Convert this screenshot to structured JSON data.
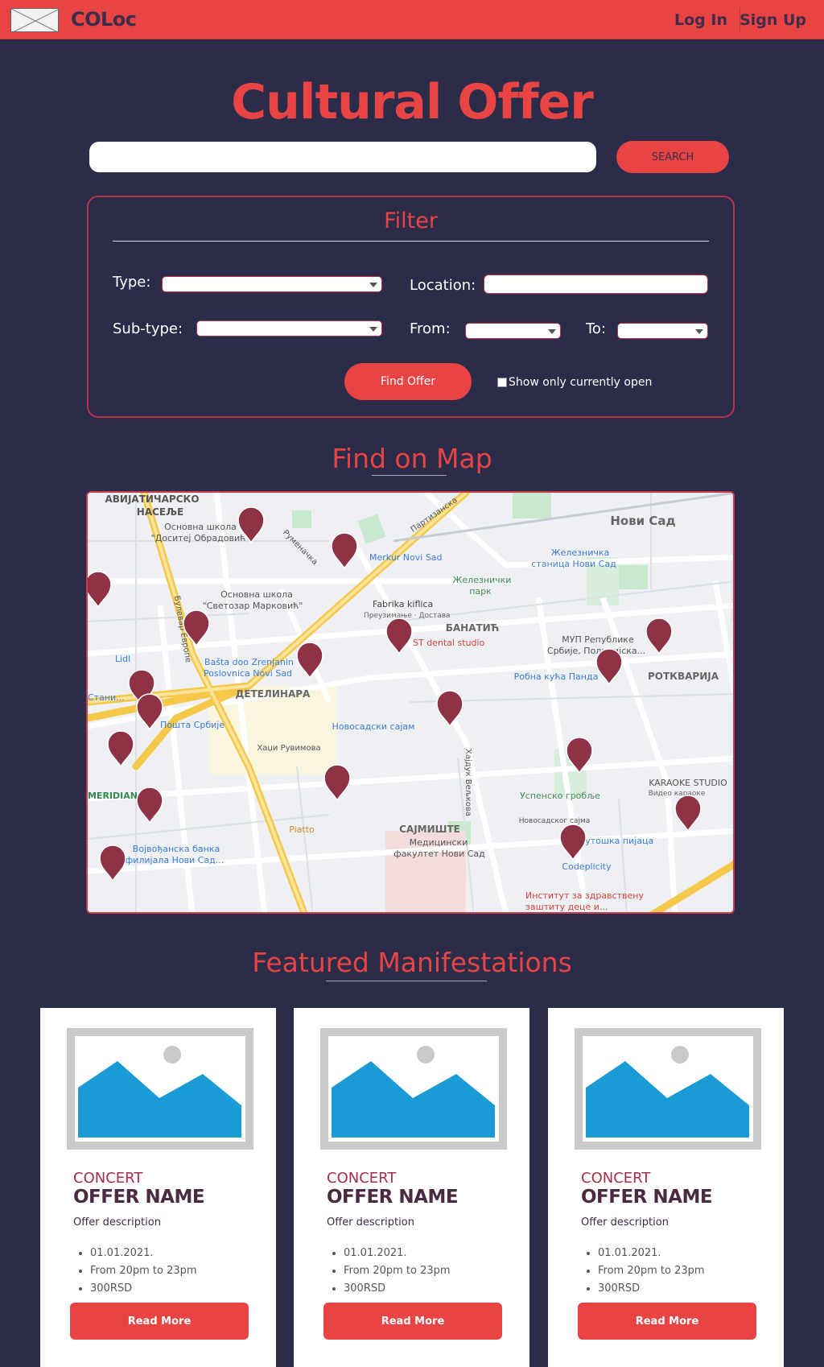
{
  "header": {
    "brand": "COLoc",
    "login_label": "Log In",
    "signup_label": "Sign Up"
  },
  "hero": {
    "title": "Cultural Offer",
    "search_value": "",
    "search_button": "SEARCH"
  },
  "filter": {
    "title": "Filter",
    "type_label": "Type:",
    "location_label": "Location:",
    "subtype_label": "Sub-type:",
    "from_label": "From:",
    "to_label": "To:",
    "find_button": "Find Offer",
    "open_checkbox_label": "Show only currently open"
  },
  "map_section": {
    "title": "Find on Map",
    "labels": [
      "АВИЈАТИЧАРСКО",
      "НАСЕЉЕ",
      "Основна школа",
      "\"Доситеј Обрадовић\"",
      "Нови Сад",
      "Merkur Novi Sad",
      "Железничка",
      "станица Нови Сад",
      "Железнички",
      "парк",
      "Основна школа",
      "\"Светозар Марковић\"",
      "Fabrika kiflica",
      "Преузимање · Достава",
      "БАНАТИЋ",
      "ST dental studio",
      "МУП Републике",
      "Србије, Полицијска...",
      "Lidl",
      "Bašta doo Zrenjanin",
      "Poslovnica Novi Sad",
      "Робна кућа Панда",
      "РОТКВАРИЈА",
      "ДЕТЕЛИНАРА",
      "Новосадски сајам",
      "Пошта Србије",
      "Хаџи Рувимова",
      "Успенско гробље",
      "KARAOKE STUDIO",
      "Видео караоке",
      "MERIDIANA",
      "Piatto",
      "САЈМИШТЕ",
      "Медицински",
      "факултет Нови Сад",
      "Футошка пијаца",
      "Војвођанска банка",
      "филијала Нови Сад...",
      "Codeplicity",
      "Институт за здравствену",
      "заштиту деце и...",
      "Булевар Европе",
      "Руменачка",
      "Партизанска",
      "Новосадског сајма",
      "Хајдук Вељкова",
      "Стани..."
    ]
  },
  "featured": {
    "title": "Featured Manifestations",
    "cards": [
      {
        "type": "CONCERT",
        "name": "OFFER NAME",
        "description": "Offer description",
        "date": "01.01.2021.",
        "time": "From 20pm to 23pm",
        "price": "300RSD",
        "button": "Read More"
      },
      {
        "type": "CONCERT",
        "name": "OFFER NAME",
        "description": "Offer description",
        "date": "01.01.2021.",
        "time": "From 20pm to 23pm",
        "price": "300RSD",
        "button": "Read More"
      },
      {
        "type": "CONCERT",
        "name": "OFFER NAME",
        "description": "Offer description",
        "date": "01.01.2021.",
        "time": "From 20pm to 23pm",
        "price": "300RSD",
        "button": "Read More"
      }
    ]
  },
  "colors": {
    "accent": "#e94444",
    "background": "#2b2c4a",
    "marker": "#8e3346",
    "dark_text": "#3d2c4a"
  }
}
